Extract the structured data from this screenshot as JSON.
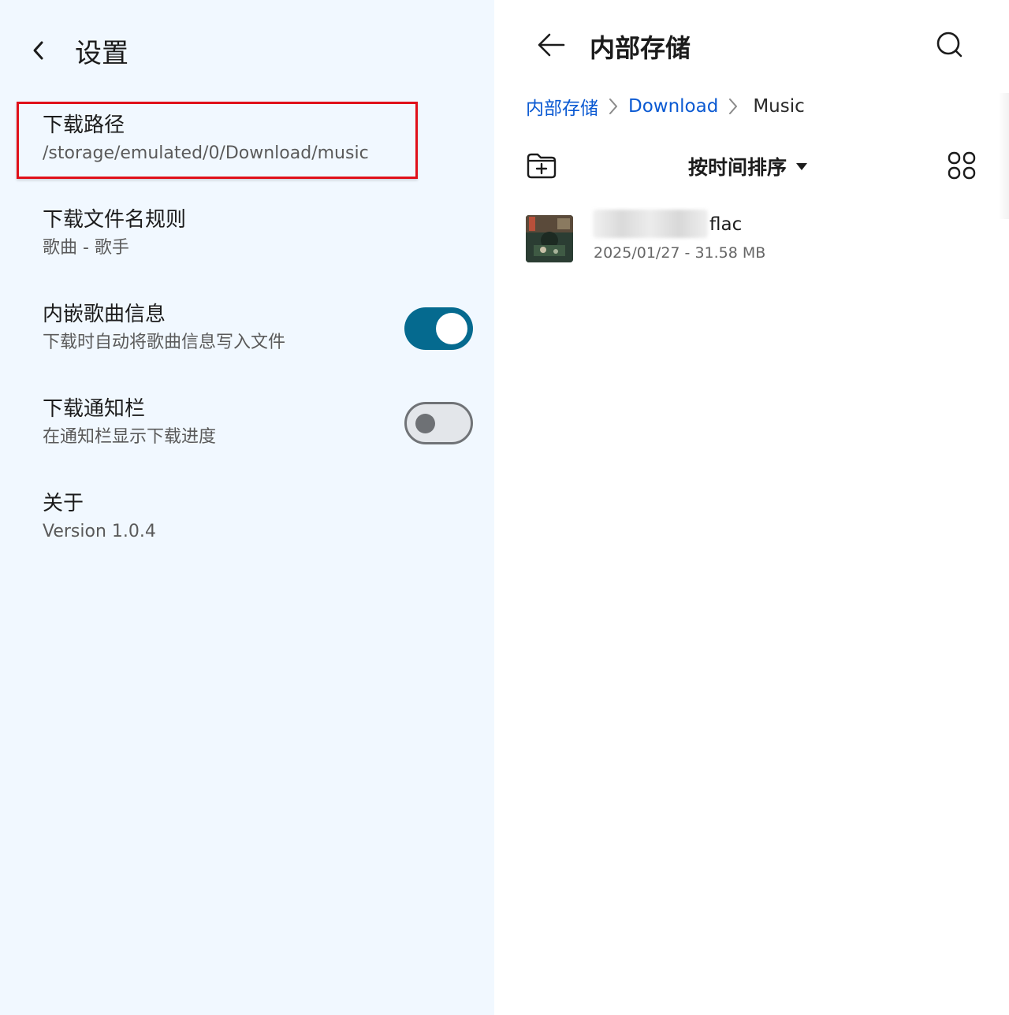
{
  "settings": {
    "title": "设置",
    "items": [
      {
        "label": "下载路径",
        "sub": "/storage/emulated/0/Download/music"
      },
      {
        "label": "下载文件名规则",
        "sub": "歌曲 - 歌手"
      },
      {
        "label": "内嵌歌曲信息",
        "sub": "下载时自动将歌曲信息写入文件",
        "toggle": true
      },
      {
        "label": "下载通知栏",
        "sub": "在通知栏显示下载进度",
        "toggle": false
      },
      {
        "label": "关于",
        "sub": "Version 1.0.4"
      }
    ]
  },
  "files": {
    "title": "内部存储",
    "breadcrumb": [
      "内部存储",
      "Download",
      "Music"
    ],
    "sort_label": "按时间排序",
    "list": [
      {
        "name_suffix": "flac",
        "meta": "2025/01/27 - 31.58 MB"
      }
    ]
  },
  "colors": {
    "left_bg": "#f1f8ff",
    "toggle_on": "#056a8f",
    "highlight_border": "#e0101a",
    "link": "#0a59d2"
  },
  "icons": [
    "back-chevron-icon",
    "arrow-left-icon",
    "search-icon",
    "chevron-right-icon",
    "new-folder-icon",
    "caret-down-icon",
    "grid-view-icon"
  ]
}
